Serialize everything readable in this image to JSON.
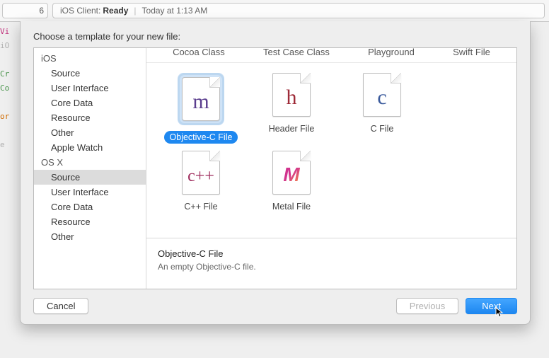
{
  "topbar": {
    "left_seg": "6",
    "client_label": "iOS Client:",
    "state": "Ready",
    "time": "Today at 1:13 AM"
  },
  "ghost_lines": [
    "Vi",
    "iO",
    "",
    "Cr",
    "Co",
    "",
    "or",
    "",
    "e"
  ],
  "header": "Choose a template for your new file:",
  "sidebar": {
    "sections": [
      {
        "title": "iOS",
        "items": [
          "Source",
          "User Interface",
          "Core Data",
          "Resource",
          "Other",
          "Apple Watch"
        ]
      },
      {
        "title": "OS X",
        "items": [
          "Source",
          "User Interface",
          "Core Data",
          "Resource",
          "Other"
        ]
      }
    ],
    "selected": {
      "section": 1,
      "item": 0
    }
  },
  "header_row": [
    "Cocoa Class",
    "Test Case Class",
    "Playground",
    "Swift File"
  ],
  "templates": [
    {
      "label": "Objective-C File",
      "glyph": "m",
      "color": "col-m",
      "selected": true
    },
    {
      "label": "Header File",
      "glyph": "h",
      "color": "col-h",
      "selected": false
    },
    {
      "label": "C File",
      "glyph": "c",
      "color": "col-c",
      "selected": false
    },
    {
      "label": "C++ File",
      "glyph": "c++",
      "color": "col-cpp",
      "selected": false
    },
    {
      "label": "Metal File",
      "glyph": "M",
      "metal": true,
      "selected": false
    }
  ],
  "description": {
    "title": "Objective-C File",
    "detail": "An empty Objective-C file."
  },
  "buttons": {
    "cancel": "Cancel",
    "previous": "Previous",
    "next": "Next"
  }
}
